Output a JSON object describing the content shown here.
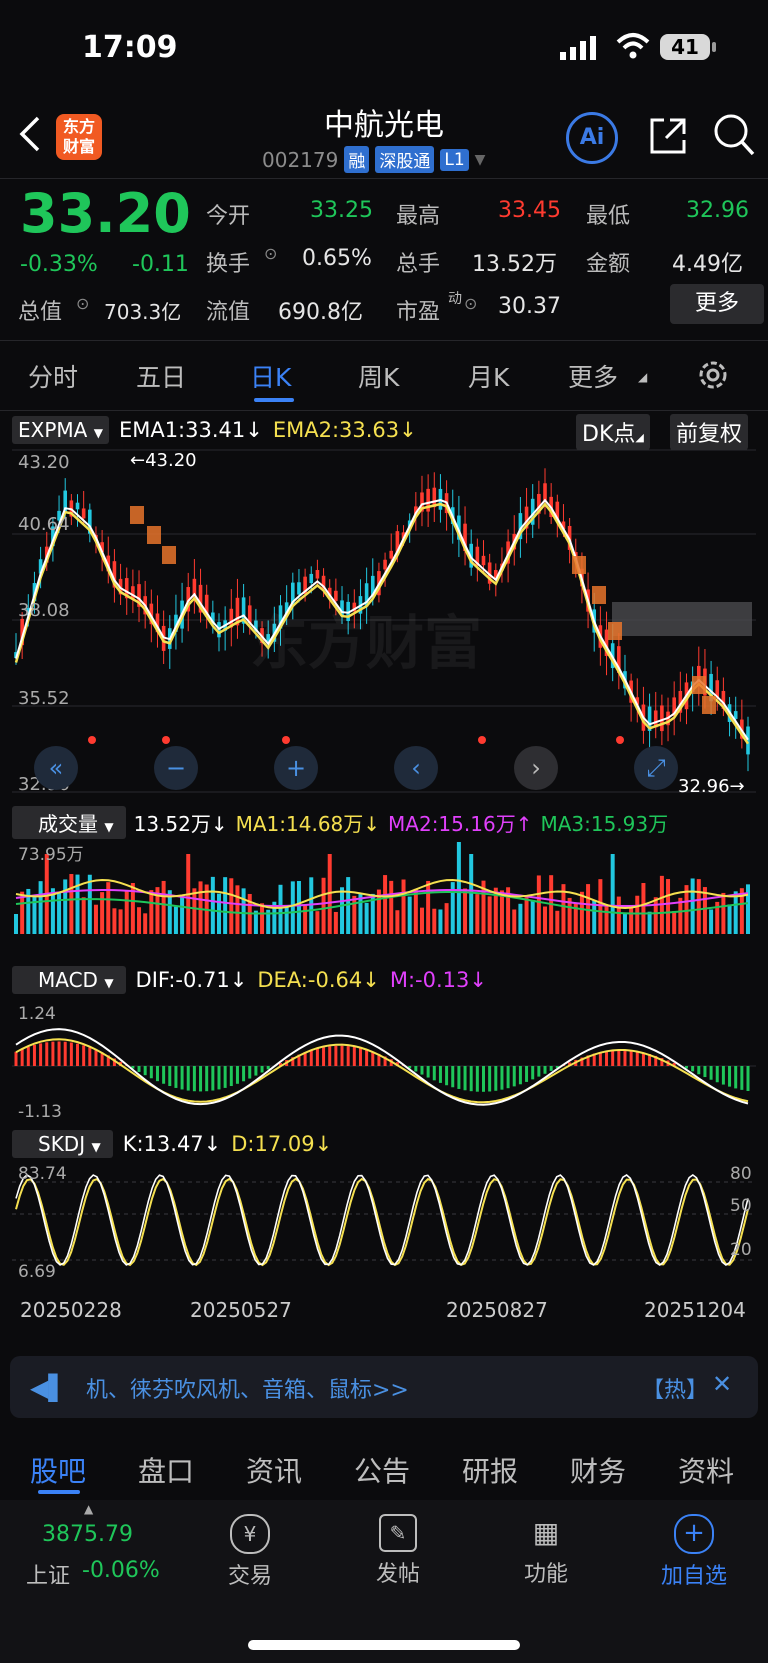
{
  "status": {
    "time": "17:09",
    "battery": "41"
  },
  "header": {
    "title": "中航光电",
    "code": "002179",
    "tags": [
      "融",
      "深股通",
      "L1"
    ],
    "logo": "东方\n财富",
    "ai": "Ai"
  },
  "quote": {
    "price": "33.20",
    "change_pct": "-0.33%",
    "change": "-0.11",
    "open_label": "今开",
    "open": "33.25",
    "high_label": "最高",
    "high": "33.45",
    "low_label": "最低",
    "low": "32.96",
    "turnover_label": "换手",
    "turnover": "0.65%",
    "volume_label": "总手",
    "volume": "13.52万",
    "amount_label": "金额",
    "amount": "4.49亿",
    "mktcap_label": "总值",
    "mktcap": "703.3亿",
    "float_label": "流值",
    "float": "690.8亿",
    "pe_label": "市盈",
    "pe_sup": "动",
    "pe": "30.37",
    "more": "更多"
  },
  "tabs": [
    "分时",
    "五日",
    "日K",
    "周K",
    "月K",
    "更多"
  ],
  "active_tab": "日K",
  "main_ind": {
    "name": "EXPMA",
    "ema1": "EMA1:33.41↓",
    "ema2": "EMA2:33.63↓",
    "dk": "DK点",
    "adj": "前复权",
    "y_labels": [
      "43.20",
      "40.64",
      "38.08",
      "35.52",
      "32.96"
    ],
    "hi_note": "←43.20",
    "lo_note": "32.96→",
    "watermark": "东方财富"
  },
  "vol_ind": {
    "name": "成交量",
    "v": "13.52万↓",
    "ma1": "MA1:14.68万↓",
    "ma2": "MA2:15.16万↑",
    "ma3": "MA3:15.93万",
    "top": "73.95万"
  },
  "macd_ind": {
    "name": "MACD",
    "dif": "DIF:-0.71↓",
    "dea": "DEA:-0.64↓",
    "m": "M:-0.13↓",
    "top": "1.24",
    "bottom": "-1.13"
  },
  "skdj_ind": {
    "name": "SKDJ",
    "k": "K:13.47↓",
    "d": "D:17.09↓",
    "top": "83.74",
    "bottom": "6.69",
    "right": [
      "80",
      "50",
      "20"
    ]
  },
  "dates": [
    "20250228",
    "20250527",
    "20250827",
    "20251204"
  ],
  "news": {
    "text": "机、徕芬吹风机、音箱、鼠标>>",
    "hot": "【热】"
  },
  "bottom_tabs": [
    "股吧",
    "盘口",
    "资讯",
    "公告",
    "研报",
    "财务",
    "资料"
  ],
  "footer": {
    "index_value": "3875.79",
    "index_name": "上证",
    "index_chg": "-0.06%",
    "items": [
      "交易",
      "发帖",
      "功能",
      "加自选"
    ]
  },
  "colors": {
    "up": "#ff3b30",
    "down": "#1fc65a",
    "accent": "#3b82f6",
    "ema1": "#ffffff",
    "ema2": "#f5e050",
    "magenta": "#e040fb",
    "cyan": "#22c8e0"
  }
}
